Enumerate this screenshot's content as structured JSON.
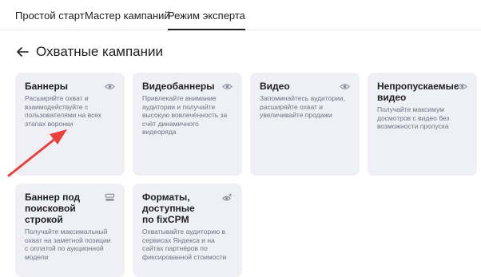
{
  "tabs": [
    {
      "label": "Простой старт",
      "active": false
    },
    {
      "label": "Мастер кампаний",
      "active": false
    },
    {
      "label": "Режим эксперта",
      "active": true
    }
  ],
  "page": {
    "title": "Охватные кампании"
  },
  "cards": [
    {
      "title": "Баннеры",
      "desc": "Расширяйте охват и взаимодействуйте с пользователями на всех этапах воронки",
      "icon": "eye-icon"
    },
    {
      "title": "Видеобаннеры",
      "desc": "Привлекайте внимание аудитории и получайте высокую вовлечённость за счёт динамичного видеоряда",
      "icon": "eye-icon"
    },
    {
      "title": "Видео",
      "desc": "Запоминайтесь аудитории, расширяйте охват и увеличивайте продажи",
      "icon": "eye-icon"
    },
    {
      "title": "Непропускаемые видео",
      "desc": "Получайте максимум досмотров с видео без возможности пропуска",
      "icon": "eye-icon"
    },
    {
      "title": "Баннер под поисковой строкой",
      "desc": "Получайте максимальный охват на заметной позиции с оплатой по аукционной модели",
      "icon": "banner-icon"
    },
    {
      "title": "Форматы, доступные по fixCPM",
      "desc": "Охватывайте аудиторию в сервисах Яндекса и на сайтах партнёров по фиксированной стоимости",
      "icon": "eye-plus-icon"
    }
  ],
  "colors": {
    "card_bg": "#eef0f6",
    "annotation_arrow": "#e8423a",
    "text": "#1f1f1f",
    "muted": "#6d7380"
  }
}
